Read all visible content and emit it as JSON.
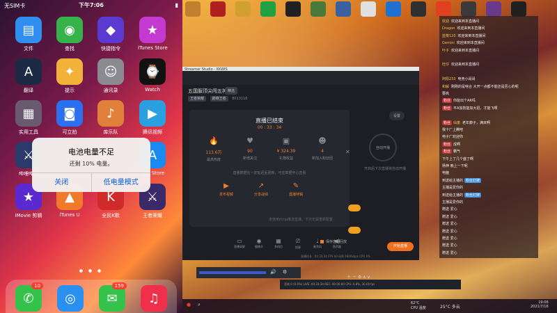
{
  "phone": {
    "status": {
      "carrier": "无SIM卡",
      "time": "下午7:06",
      "battery": "10%"
    },
    "apps": [
      {
        "label": "文件",
        "icon": "folder-icon",
        "color": "#2f8ef0"
      },
      {
        "label": "查找",
        "icon": "find-my-icon",
        "color": "#35b24a"
      },
      {
        "label": "快捷指令",
        "icon": "shortcuts-icon",
        "color": "#5a3ad0"
      },
      {
        "label": "iTunes Store",
        "icon": "star-icon",
        "color": "#c43ad0"
      },
      {
        "label": "翻译",
        "icon": "translate-icon",
        "color": "#1c2a44"
      },
      {
        "label": "提示",
        "icon": "bulb-icon",
        "color": "#f2b23a"
      },
      {
        "label": "通讯录",
        "icon": "contacts-icon",
        "color": "#8a8a90"
      },
      {
        "label": "Watch",
        "icon": "watch-icon",
        "color": "#111111"
      },
      {
        "label": "实用工具",
        "icon": "folder-grid-icon",
        "color": "#6a5a70"
      },
      {
        "label": "可立拍",
        "icon": "clips-icon",
        "color": "#2a70f0"
      },
      {
        "label": "库乐队",
        "icon": "guitar-icon",
        "color": "#e0803a"
      },
      {
        "label": "腾讯视频",
        "icon": "play-icon",
        "color": "#2aa0e0"
      },
      {
        "label": "哔哩哔哩",
        "icon": "game-icon",
        "color": "#2a3a6a"
      },
      {
        "label": "",
        "icon": "blank",
        "color": "transparent"
      },
      {
        "label": "",
        "icon": "blank",
        "color": "transparent"
      },
      {
        "label": "App Store",
        "icon": "appstore-icon",
        "color": "#1a8af0"
      },
      {
        "label": "iMovie 剪辑",
        "icon": "imovie-icon",
        "color": "#5a2ad0"
      },
      {
        "label": "iTunes U",
        "icon": "graduation-icon",
        "color": "#f07a2a"
      },
      {
        "label": "全民K歌",
        "icon": "ksong-icon",
        "color": "#d02a2a"
      },
      {
        "label": "王者荣耀",
        "icon": "hok-icon",
        "color": "#3a2a6a"
      }
    ],
    "alert": {
      "title": "电池电量不足",
      "message": "还剩 10% 电量。",
      "btn_close": "关闭",
      "btn_lowpower": "低电量模式"
    },
    "dock": [
      {
        "icon": "phone-icon",
        "color": "#35c24a",
        "badge": "10"
      },
      {
        "icon": "safari-icon",
        "color": "#2a90f0",
        "badge": ""
      },
      {
        "icon": "messages-icon",
        "color": "#35c24a",
        "badge": "159"
      },
      {
        "icon": "music-icon",
        "color": "#f0304a",
        "badge": ""
      }
    ]
  },
  "desktop": {
    "window_title": "Streamer Studio - KKWIS",
    "stream": {
      "room_title": "五国服顶尖闯五神",
      "room_tag": "精选",
      "room_chips": [
        "王者荣耀",
        "巅峰王者"
      ],
      "room_id": "8013116",
      "end_title": "直播已结束",
      "end_time": "00 : 33 : 34",
      "stats": [
        {
          "value": "113.6万",
          "label": "最高热度",
          "icon": "fire-icon"
        },
        {
          "value": "90",
          "label": "新增关注",
          "icon": "heart-icon"
        },
        {
          "value": "¥ 324.39",
          "label": "礼物收益",
          "icon": "gift-icon"
        },
        {
          "value": "4",
          "label": "新加入粉丝团",
          "icon": "fans-icon"
        }
      ],
      "end_note": "直播数据在一定延迟后更新，可在数据中心查看",
      "actions": [
        {
          "label": "发布视频",
          "icon": "video-icon"
        },
        {
          "label": "分享战绩",
          "icon": "share-icon"
        },
        {
          "label": "直播特辑",
          "icon": "edit-icon"
        }
      ],
      "auto_save": "保存直播回放",
      "settings_label": "设置",
      "circle_label": "自动开播",
      "circle_note": "开启后下次直播将自动开播",
      "hint": "未使用rtmp推流直播，下次无需重新配置",
      "tools": [
        {
          "label": "直播录屏",
          "icon": "screen-icon"
        },
        {
          "label": "摄像头",
          "icon": "camera-icon"
        },
        {
          "label": "多机位",
          "icon": "multi-icon"
        },
        {
          "label": "投屏",
          "icon": "cast-icon"
        },
        {
          "label": "麦克风",
          "icon": "mic-icon"
        },
        {
          "label": "扬声器",
          "icon": "speaker-icon"
        }
      ],
      "start_button": "开始直播",
      "statusline": "直播时长 : 00:33:34   FPS 60   码率 4800kbps   CPU 6%"
    },
    "obs": {
      "status": "丢帧 0 (0.0%)  LIVE: 00:33:34  REC: 00:00:00  CPU: 0.8%, 30.00 fps"
    },
    "taskbar": {
      "weather": "25°C 多云",
      "temp_label": "62°C",
      "cpu_label": "CPU 温度",
      "time": "19:06",
      "date": "2021/7/16"
    },
    "chat": [
      {
        "user": "欢迎",
        "badge": "",
        "text": "欢迎来到本直播间",
        "gift": ""
      },
      {
        "user": "Dragon",
        "badge": "",
        "text": "欢迎来到本直播间",
        "gift": ""
      },
      {
        "user": "蓝莓120",
        "badge": "",
        "text": "欢迎来到本直播间",
        "gift": ""
      },
      {
        "user": "Gemini",
        "badge": "",
        "text": "欢迎来到本直播间",
        "gift": ""
      },
      {
        "user": "叶子",
        "badge": "",
        "text": "欢迎来到本直播间",
        "gift": ""
      },
      {
        "user": "",
        "badge": "",
        "text": "",
        "gift": ""
      },
      {
        "user": "旺仔",
        "badge": "",
        "text": "欢迎来到本直播间",
        "gift": ""
      },
      {
        "user": "",
        "badge": "",
        "text": "",
        "gift": ""
      },
      {
        "user": "阿阳233",
        "badge": "",
        "text": "电竞小哥哥",
        "gift": ""
      },
      {
        "user": "和解",
        "badge": "",
        "text": "刚刚的是啥合 大开一点都不能还是否心的呢",
        "gift": ""
      },
      {
        "user": "",
        "badge": "",
        "text": "要高",
        "gift": ""
      },
      {
        "user": "",
        "badge": "粉丝",
        "text": "你能出个AR吗",
        "gift": ""
      },
      {
        "user": "",
        "badge": "粉丝",
        "text": "平A加技能加大招，才能飞啊",
        "gift": ""
      },
      {
        "user": "",
        "badge": "",
        "text": "",
        "gift": ""
      },
      {
        "user": "仙童",
        "badge": "粉丝",
        "text": "老年癖子，满目啊",
        "gift": ""
      },
      {
        "user": "",
        "badge": "",
        "text": "我十厂上腾吧",
        "gift": ""
      },
      {
        "user": "",
        "badge": "",
        "text": "电子厂欢迎你",
        "gift": ""
      },
      {
        "user": "",
        "badge": "粉丝",
        "text": "成啊",
        "gift": ""
      },
      {
        "user": "",
        "badge": "粉丝",
        "text": "霸气",
        "gift": ""
      },
      {
        "user": "",
        "badge": "",
        "text": "下午上了几个盛了啊",
        "gift": ""
      },
      {
        "user": "",
        "badge": "",
        "text": "杨神 晚上一下呢",
        "gift": ""
      },
      {
        "user": "",
        "badge": "",
        "text": "电脑",
        "gift": ""
      },
      {
        "user": "",
        "badge": "",
        "text": "到送给主播的",
        "gift": "粉丝灯牌"
      },
      {
        "user": "",
        "badge": "",
        "text": "主播是爱你的",
        "gift": ""
      },
      {
        "user": "",
        "badge": "",
        "text": "到送给主播的",
        "gift": "粉丝灯牌"
      },
      {
        "user": "",
        "badge": "",
        "text": "主播是爱你的",
        "gift": ""
      },
      {
        "user": "",
        "badge": "",
        "text": "赠送 爱心",
        "gift": ""
      },
      {
        "user": "",
        "badge": "",
        "text": "赠送 爱心",
        "gift": ""
      },
      {
        "user": "",
        "badge": "",
        "text": "赠送 爱心",
        "gift": ""
      },
      {
        "user": "",
        "badge": "",
        "text": "赠送 爱心",
        "gift": ""
      },
      {
        "user": "",
        "badge": "",
        "text": "赠送 爱心",
        "gift": ""
      },
      {
        "user": "",
        "badge": "",
        "text": "赠送 爱心",
        "gift": ""
      },
      {
        "user": "",
        "badge": "",
        "text": "赠送 爱心",
        "gift": ""
      }
    ]
  }
}
